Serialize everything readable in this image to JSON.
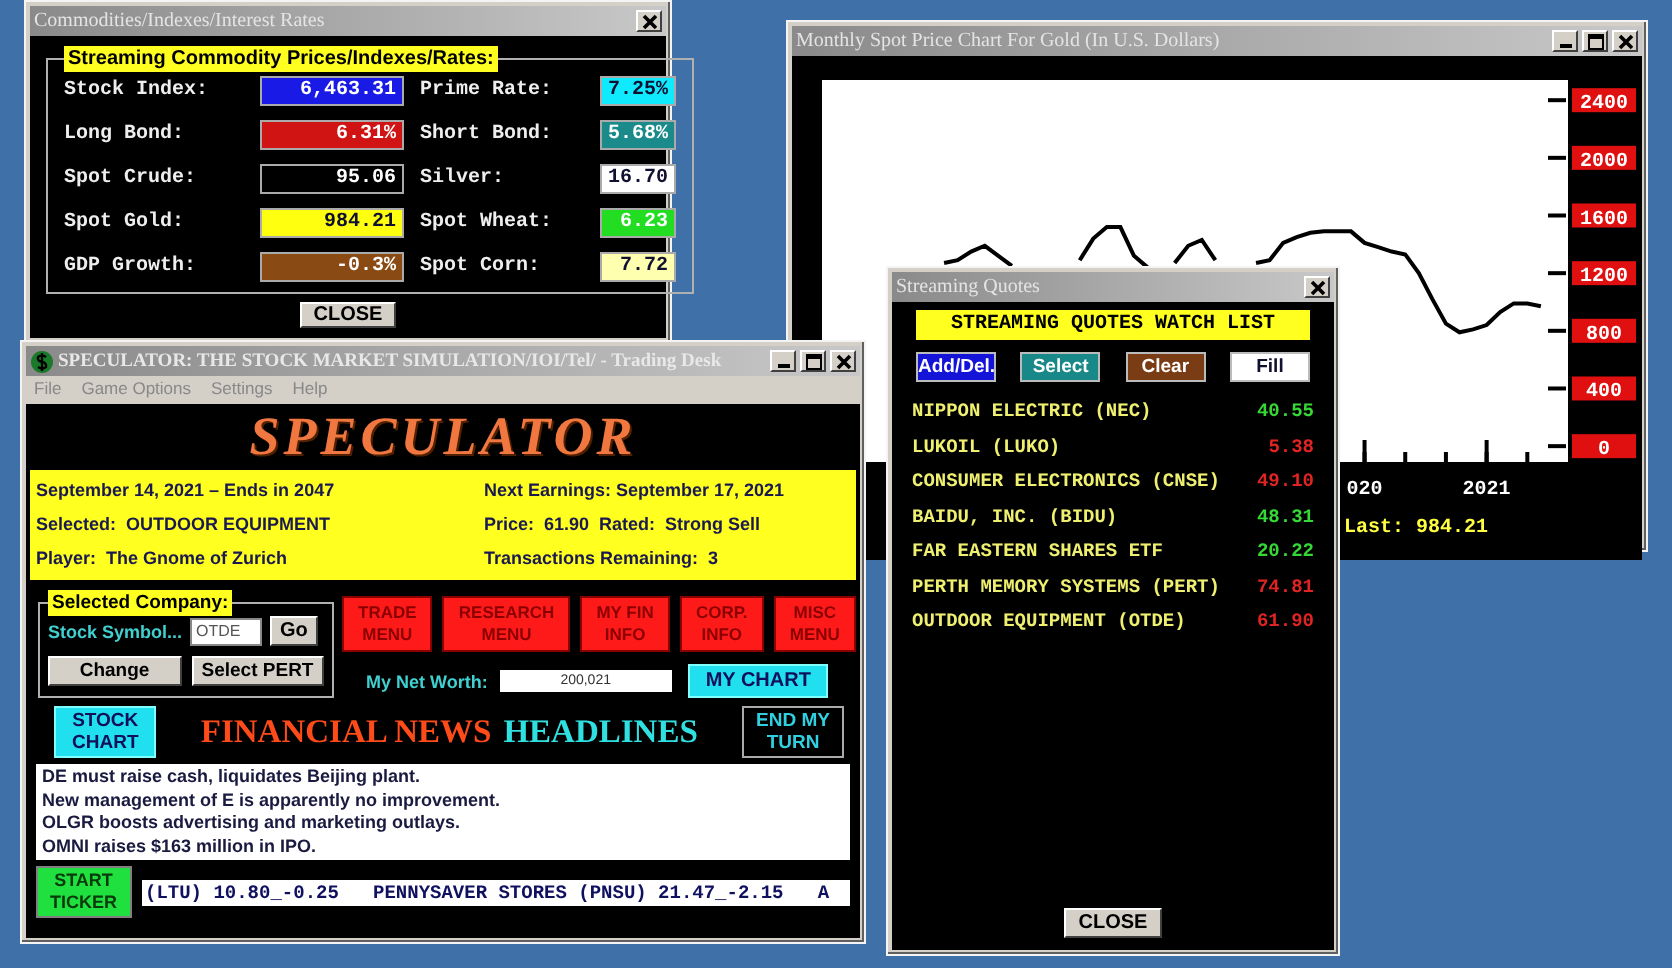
{
  "commodities_window": {
    "title": "Commodities/Indexes/Interest Rates",
    "group_title": "Streaming Commodity Prices/Indexes/Rates:",
    "rates": [
      {
        "label": "Stock Index:",
        "value": "6,463.31",
        "color": "#1a1ae6"
      },
      {
        "label": "Prime Rate:",
        "value": "7.25%",
        "color": "#10eaff"
      },
      {
        "label": "Long Bond:",
        "value": "6.31%",
        "color": "#d01414"
      },
      {
        "label": "Short Bond:",
        "value": "5.68%",
        "color": "#1a8a8a"
      },
      {
        "label": "Spot Crude:",
        "value": "95.06",
        "color": "#000000"
      },
      {
        "label": "Silver:",
        "value": "16.70",
        "color": "#ffffff"
      },
      {
        "label": "Spot Gold:",
        "value": "984.21",
        "color": "#ffff10"
      },
      {
        "label": "Spot Wheat:",
        "value": "6.23",
        "color": "#22dd22"
      },
      {
        "label": "GDP Growth:",
        "value": "-0.3%",
        "color": "#8a4a14"
      },
      {
        "label": "Spot Corn:",
        "value": "7.72",
        "color": "#ffffb0"
      }
    ],
    "close_button": "CLOSE"
  },
  "chart_window": {
    "title": "Monthly Spot Price Chart For Gold (In U.S. Dollars)",
    "chart_data": {
      "type": "line",
      "categories": [
        null,
        null,
        null,
        null,
        null,
        null,
        null,
        null,
        null,
        null,
        null,
        null,
        null,
        null,
        null,
        null,
        null,
        null,
        null,
        null,
        null,
        null,
        null,
        null,
        null,
        null,
        null,
        null,
        null,
        null,
        null,
        "020",
        null,
        null,
        null,
        null,
        null,
        null,
        null,
        null,
        "2021",
        null,
        null,
        null,
        null
      ],
      "series": [
        {
          "color": "#000000",
          "values": [
            1270,
            1290,
            1350,
            1390,
            1320,
            1250,
            null,
            null,
            null,
            null,
            1290,
            1440,
            1520,
            1520,
            1320,
            1240,
            null,
            1270,
            1390,
            1430,
            1290,
            null,
            null,
            1270,
            1290,
            1410,
            1450,
            1480,
            1490,
            1490,
            1490,
            1410,
            1380,
            1350,
            1330,
            1200,
            1020,
            850,
            790,
            810,
            840,
            930,
            990,
            990,
            970
          ]
        }
      ],
      "ylim": [
        -110,
        2540
      ],
      "yticks": [
        0,
        400,
        800,
        1200,
        1600,
        2000,
        2400
      ]
    },
    "last_price": "Last: 984.21"
  },
  "speculator_window": {
    "title": "SPECULATOR: THE STOCK MARKET SIMULATION/IOI/Tel/ - Trading Desk",
    "menu": [
      "File",
      "Game Options",
      "Settings",
      "Help"
    ],
    "logo": "SPECULATOR",
    "info_left": [
      "September 14, 2021 – Ends in 2047",
      "Selected:  OUTDOOR EQUIPMENT",
      "Player:  The Gnome of Zurich"
    ],
    "info_right": [
      "Next Earnings: September 17, 2021",
      "Price:  61.90  Rated:  Strong Sell",
      "Transactions Remaining:  3"
    ],
    "selected_company": {
      "title": "Selected Company:",
      "symbol_label": "Stock Symbol...",
      "symbol_value": "OTDE",
      "go_button": "Go",
      "buttons": [
        "Change",
        "Select PERT"
      ]
    },
    "menu_buttons": [
      {
        "lines": [
          "TRADE",
          "MENU"
        ]
      },
      {
        "lines": [
          "RESEARCH",
          "MENU"
        ]
      },
      {
        "lines": [
          "MY FIN",
          "INFO"
        ]
      },
      {
        "lines": [
          "CORP.",
          "INFO"
        ]
      },
      {
        "lines": [
          "MISC",
          "MENU"
        ]
      }
    ],
    "net_worth_label": "My Net Worth:",
    "net_worth": "200,021",
    "my_chart_button": "MY CHART",
    "stock_chart_button": [
      "STOCK",
      "CHART"
    ],
    "news_title_1": "FINANCIAL NEWS",
    "news_title_2": "HEADLINES",
    "end_turn_button": [
      "END MY",
      "TURN"
    ],
    "headlines": [
      "DE must raise cash, liquidates Beijing plant.",
      "New management of E is apparently no improvement.",
      "OLGR boosts advertising and marketing outlays.",
      "OMNI raises $163 million in IPO."
    ],
    "ticker_button": [
      "START",
      "TICKER"
    ],
    "ticker_text": "(LTU) 10.80_-0.25   PENNYSAVER STORES (PNSU) 21.47_-2.15   A"
  },
  "quotes_window": {
    "title": "Streaming Quotes",
    "header": "STREAMING QUOTES WATCH LIST",
    "buttons": [
      {
        "label": "Add/Del.",
        "color": "#1414d8"
      },
      {
        "label": "Select",
        "color": "#188888"
      },
      {
        "label": "Clear",
        "color": "#7a3c14"
      },
      {
        "label": "Fill",
        "color": "#ffffff"
      }
    ],
    "quotes": [
      {
        "name": "NIPPON ELECTRIC (NEC)",
        "price": "40.55",
        "color": "#36d836"
      },
      {
        "name": "LUKOIL (LUKO)",
        "price": "5.38",
        "color": "#e02424"
      },
      {
        "name": "CONSUMER ELECTRONICS (CNSE)",
        "price": "49.10",
        "color": "#e02424"
      },
      {
        "name": "BAIDU, INC. (BIDU)",
        "price": "48.31",
        "color": "#36d836"
      },
      {
        "name": "FAR EASTERN SHARES ETF",
        "price": "20.22",
        "color": "#36d836"
      },
      {
        "name": "PERTH MEMORY SYSTEMS (PERT)",
        "price": "74.81",
        "color": "#e02424"
      },
      {
        "name": "OUTDOOR EQUIPMENT (OTDE)",
        "price": "61.90",
        "color": "#e02424"
      }
    ],
    "close_button": "CLOSE"
  }
}
